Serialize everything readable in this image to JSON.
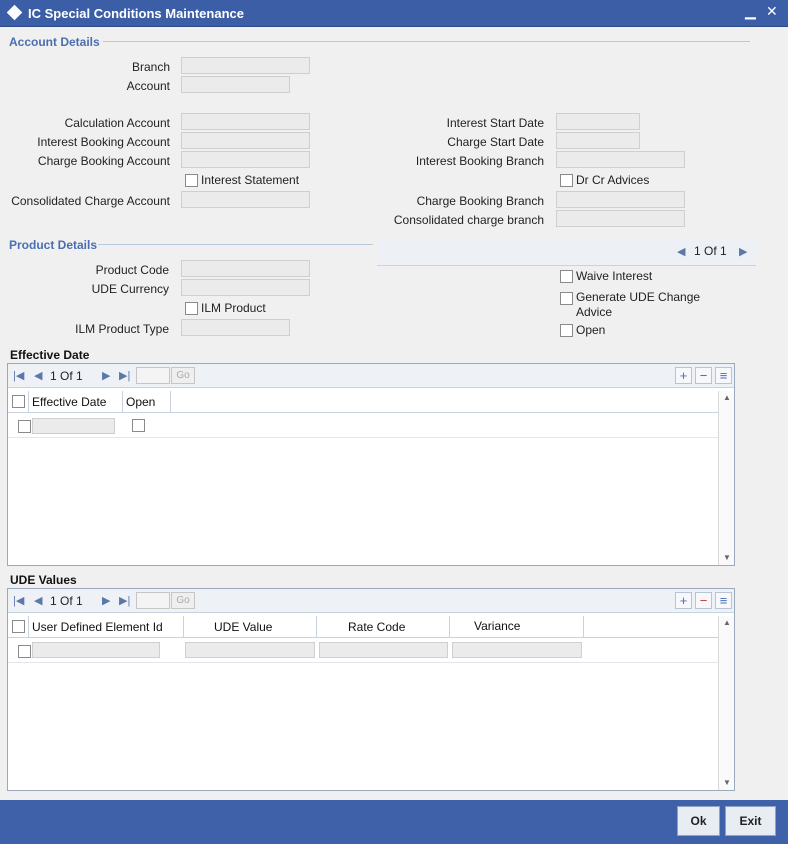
{
  "window": {
    "title": "IC Special Conditions Maintenance",
    "minimize_icon": "minimize-icon",
    "close_icon": "close-icon"
  },
  "account_details": {
    "title": "Account Details",
    "branch_label": "Branch",
    "account_label": "Account",
    "calculation_account_label": "Calculation Account",
    "interest_booking_account_label": "Interest Booking Account",
    "charge_booking_account_label": "Charge Booking Account",
    "interest_statement_label": "Interest Statement",
    "consolidated_charge_account_label": "Consolidated Charge Account",
    "interest_start_date_label": "Interest Start Date",
    "charge_start_date_label": "Charge Start Date",
    "interest_booking_branch_label": "Interest Booking Branch",
    "dr_cr_advices_label": "Dr Cr Advices",
    "charge_booking_branch_label": "Charge Booking Branch",
    "consolidated_charge_branch_label": "Consolidated charge branch"
  },
  "product_details": {
    "title": "Product Details",
    "pager": "1 Of 1",
    "product_code_label": "Product Code",
    "ude_currency_label": "UDE Currency",
    "ilm_product_label": "ILM Product",
    "ilm_product_type_label": "ILM Product Type",
    "waive_interest_label": "Waive Interest",
    "generate_ude_label_1": "Generate UDE Change",
    "generate_ude_label_2": "Advice",
    "open_label": "Open"
  },
  "effective_date_grid": {
    "title": "Effective Date",
    "pager": "1 Of 1",
    "go_label": "Go",
    "columns": [
      "Effective Date",
      "Open"
    ]
  },
  "ude_values_grid": {
    "title": "UDE Values",
    "pager": "1 Of 1",
    "go_label": "Go",
    "columns": [
      "User Defined Element Id",
      "UDE Value",
      "Rate Code",
      "Variance"
    ]
  },
  "footer": {
    "ok_label": "Ok",
    "exit_label": "Exit"
  }
}
